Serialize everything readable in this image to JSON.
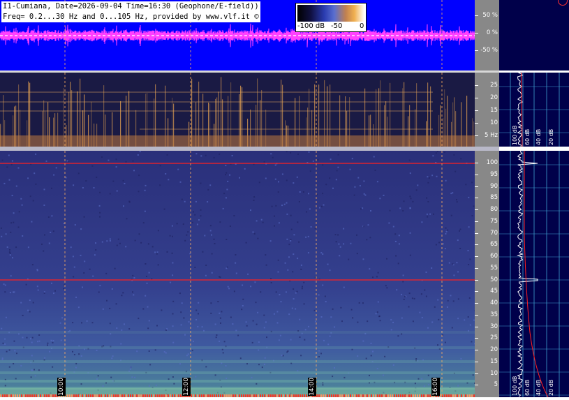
{
  "header": {
    "title_line1": "I1-Cumiana, Date=2026-09-04 Time=16:30 (Geophone/E-field))",
    "title_line2": "Freq= 0.2...30 Hz and 0...105 Hz, provided by www.vlf.it ©"
  },
  "legend": {
    "labels": [
      "-100 dB",
      "-50",
      "0"
    ]
  },
  "waveform_axis": {
    "ticks": [
      "50 %",
      "0 %",
      "-50 %"
    ]
  },
  "low_axis": {
    "ticks": [
      "25",
      "20",
      "15",
      "10",
      "5 Hz"
    ]
  },
  "high_axis": {
    "ticks": [
      "100",
      "95",
      "90",
      "85",
      "80",
      "75",
      "70",
      "65",
      "60",
      "55",
      "50",
      "45",
      "40",
      "35",
      "30",
      "25",
      "20",
      "15",
      "10",
      "5"
    ]
  },
  "profile_labels": {
    "low": [
      "100 dB",
      "60 dB",
      "40 dB",
      "20 dB"
    ],
    "high": [
      "100 dB",
      "60 dB",
      "40 dB",
      "20 dB"
    ]
  },
  "time_markers": [
    "10:00",
    "12:00",
    "14:00",
    "16:00"
  ],
  "colors": {
    "waveform_bg": "#0000ff",
    "waveform_trace": "#ff40ff",
    "spectrogram_high_bg": "#27307a",
    "spectrogram_low_bg": "#1a1a44",
    "mains_line": "#ff2020",
    "profile_bg": "#00004a",
    "grid_cyan": "#3fa0d0"
  }
}
